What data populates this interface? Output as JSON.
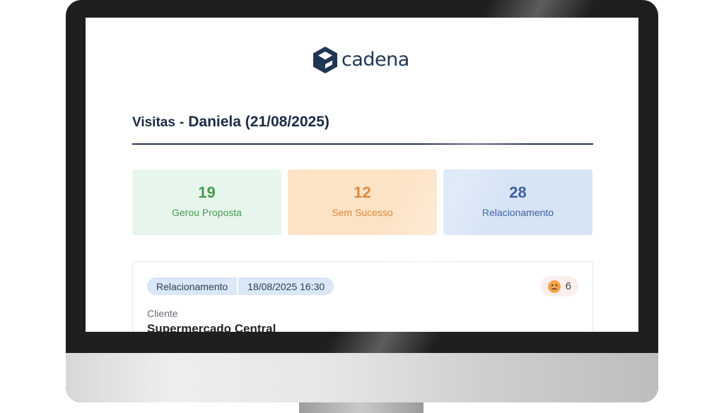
{
  "app": {
    "logo_text": "cadena"
  },
  "header": {
    "title_prefix": "Visitas",
    "title_separator": "-",
    "title_main": "Daniela (21/08/2025)"
  },
  "stats": [
    {
      "value": "19",
      "label": "Gerou Proposta",
      "color": "#4b9a50"
    },
    {
      "value": "12",
      "label": "Sem Sucesso",
      "color": "#d98a3f"
    },
    {
      "value": "28",
      "label": "Relacionamento",
      "color": "#3f5f9e"
    }
  ],
  "visit": {
    "type_tag": "Relacionamento",
    "datetime_tag": "18/08/2025 16:30",
    "reaction_icon": "sad-face-icon",
    "reaction_count": "6",
    "client_label": "Cliente",
    "client_name": "Supermercado Central"
  },
  "colors": {
    "brand": "#1f3553",
    "title_rule": "#27375a"
  }
}
